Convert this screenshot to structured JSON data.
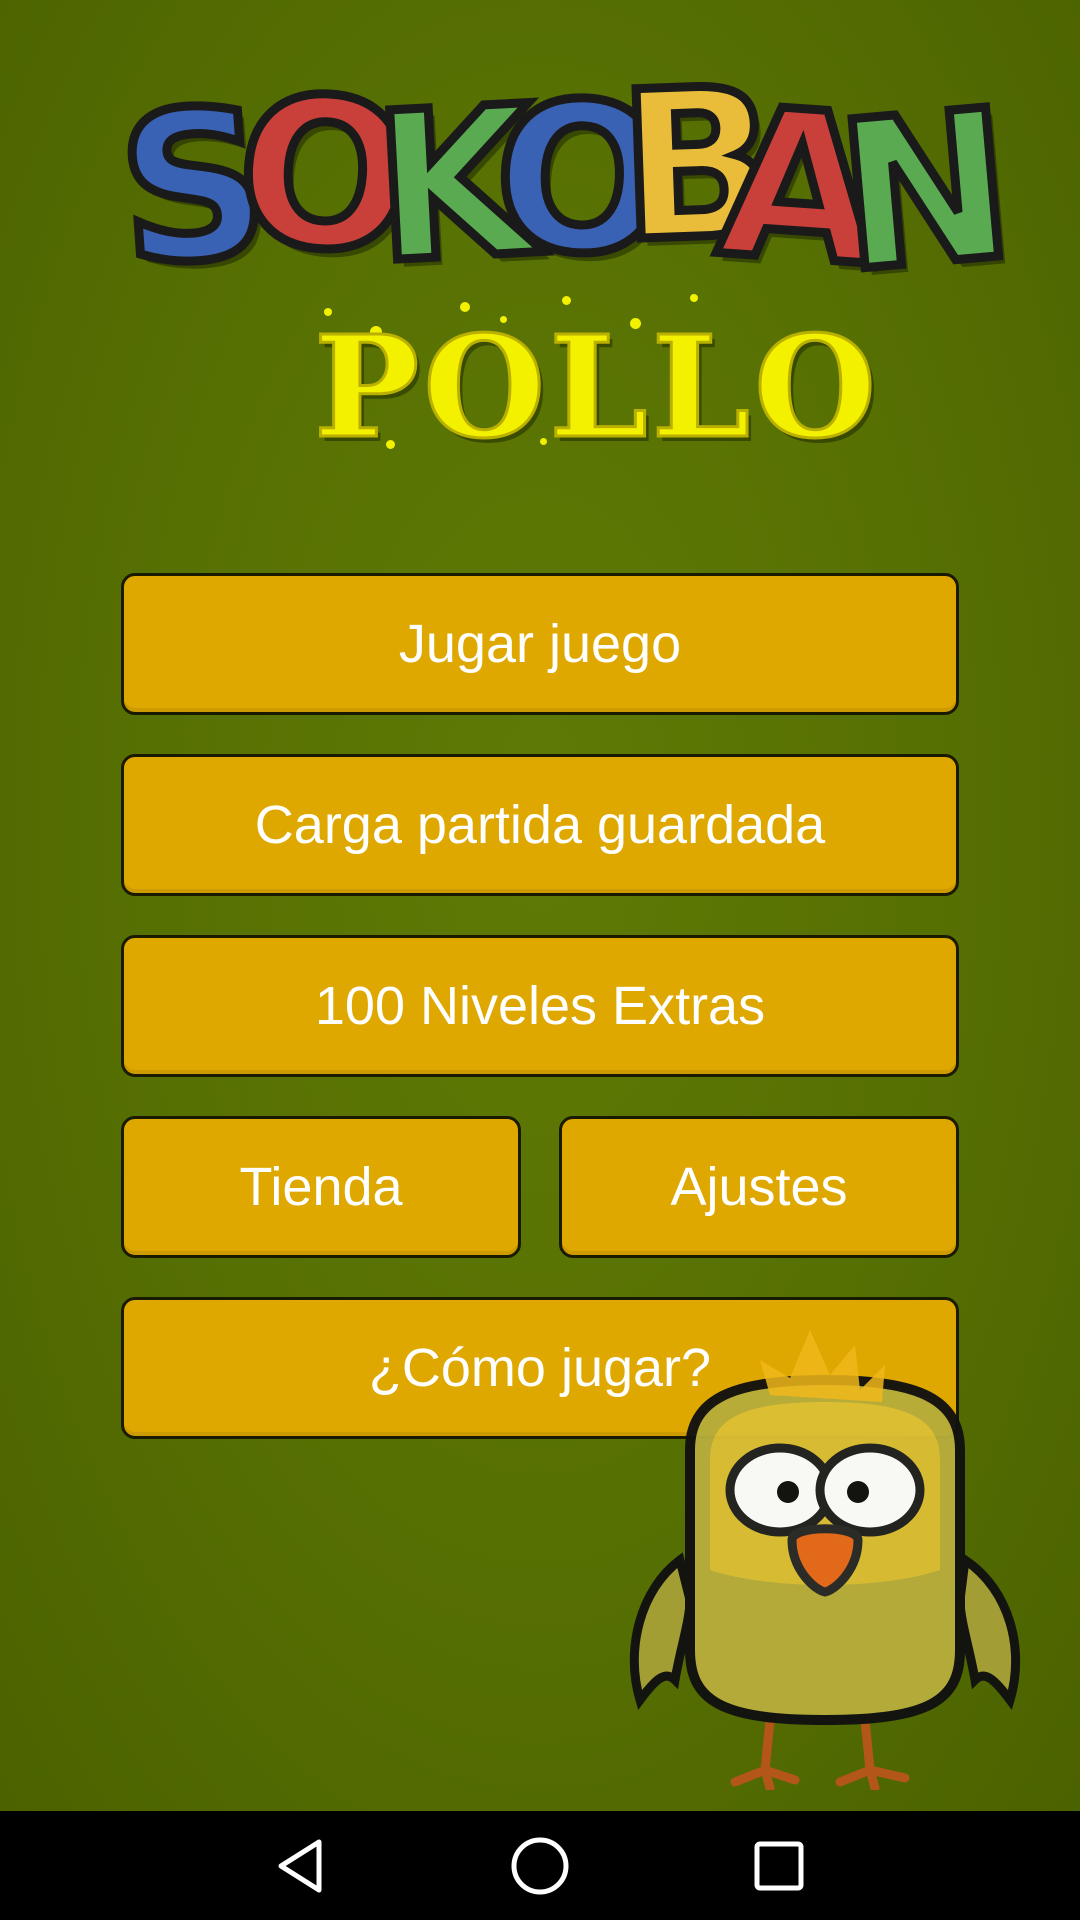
{
  "logo": {
    "title_letters": [
      "S",
      "O",
      "K",
      "O",
      "B",
      "A",
      "N"
    ],
    "subtitle": "POLLO",
    "letter_colors": [
      "#3a62b4",
      "#c9403a",
      "#5aaa52",
      "#3a62b4",
      "#e9bd3a",
      "#c9403a",
      "#5aaa52"
    ],
    "subtitle_color": "#f3f000"
  },
  "menu": {
    "play_label": "Jugar juego",
    "load_label": "Carga partida guardada",
    "extra_label": "100 Niveles Extras",
    "shop_label": "Tienda",
    "settings_label": "Ajustes",
    "howto_label": "¿Cómo jugar?"
  },
  "mascot": {
    "icon": "chick-mascot-icon"
  },
  "navbar": {
    "back_icon": "back-triangle-icon",
    "home_icon": "home-circle-icon",
    "recents_icon": "recents-square-icon"
  },
  "colors": {
    "background": "#566f02",
    "button": "#dfa800",
    "button_text": "#ffffff",
    "navbar": "#000000"
  }
}
